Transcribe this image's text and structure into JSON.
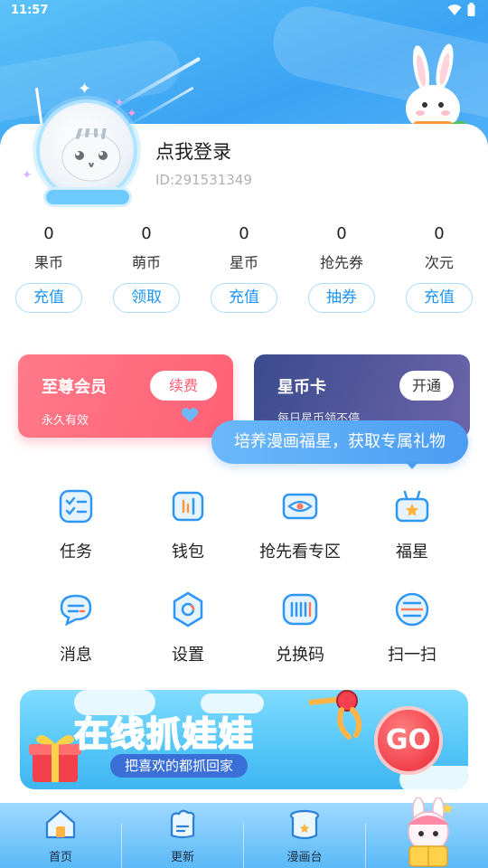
{
  "status_bar": {
    "time": "11:57"
  },
  "profile": {
    "login_text": "点我登录",
    "user_id": "ID:291531349"
  },
  "stats": [
    {
      "value": "0",
      "label": "果币",
      "action": "充值"
    },
    {
      "value": "0",
      "label": "萌币",
      "action": "领取"
    },
    {
      "value": "0",
      "label": "星币",
      "action": "充值"
    },
    {
      "value": "0",
      "label": "抢先券",
      "action": "抽券"
    },
    {
      "value": "0",
      "label": "次元",
      "action": "充值"
    }
  ],
  "vip_card": {
    "title": "至尊会员",
    "subtitle": "永久有效",
    "button": "续费"
  },
  "star_card": {
    "title": "星币卡",
    "subtitle": "每日星币领不停",
    "button": "开通"
  },
  "tooltip": {
    "text": "培养漫画福星，获取专属礼物"
  },
  "grid": [
    {
      "label": "任务",
      "icon": "task-icon"
    },
    {
      "label": "钱包",
      "icon": "wallet-icon"
    },
    {
      "label": "抢先看专区",
      "icon": "preview-zone-icon"
    },
    {
      "label": "福星",
      "icon": "lucky-star-icon"
    },
    {
      "label": "消息",
      "icon": "message-icon"
    },
    {
      "label": "设置",
      "icon": "settings-icon"
    },
    {
      "label": "兑换码",
      "icon": "redeem-code-icon"
    },
    {
      "label": "扫一扫",
      "icon": "scan-icon"
    }
  ],
  "banner": {
    "headline": "在线抓娃娃",
    "subline": "把喜欢的都抓回家",
    "go": "GO"
  },
  "tabbar": [
    {
      "label": "首页",
      "icon": "home-icon"
    },
    {
      "label": "更新",
      "icon": "update-icon"
    },
    {
      "label": "漫画台",
      "icon": "manhua-icon"
    }
  ],
  "colors": {
    "accent": "#1e95f2",
    "vip": "#ff6074",
    "star_card": "#3a4b8d",
    "tooltip": "#4b9cf3",
    "tabbar": "#5ab9f7"
  }
}
